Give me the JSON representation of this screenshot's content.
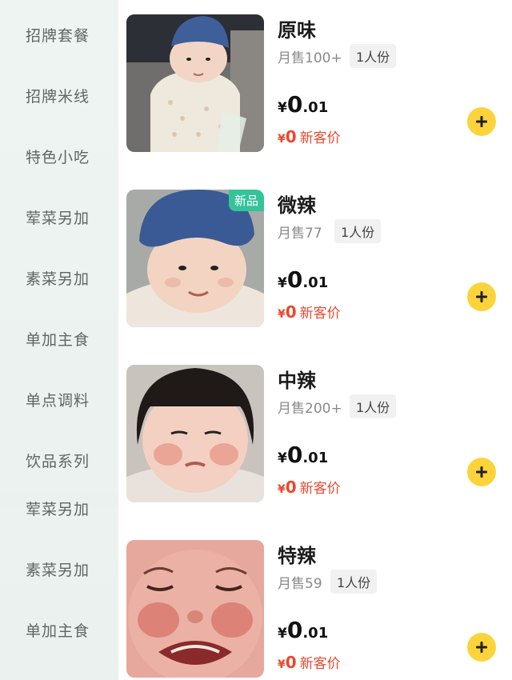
{
  "sidebar": {
    "items": [
      {
        "label": "招牌套餐"
      },
      {
        "label": "招牌米线"
      },
      {
        "label": "特色小吃"
      },
      {
        "label": "荤菜另加"
      },
      {
        "label": "素菜另加"
      },
      {
        "label": "单加主食"
      },
      {
        "label": "单点调料"
      },
      {
        "label": "饮品系列"
      },
      {
        "label": "荤菜另加"
      },
      {
        "label": "素菜另加"
      },
      {
        "label": "单加主食"
      }
    ]
  },
  "products": [
    {
      "name": "原味",
      "sales": "月售100+",
      "portion": "1人份",
      "price_currency": "¥",
      "price_int": "0",
      "price_dec": ".01",
      "new_currency": "¥",
      "new_price": "0",
      "new_label": "新客价",
      "badge": ""
    },
    {
      "name": "微辣",
      "sales": "月售77",
      "portion": "1人份",
      "price_currency": "¥",
      "price_int": "0",
      "price_dec": ".01",
      "new_currency": "¥",
      "new_price": "0",
      "new_label": "新客价",
      "badge": "新品"
    },
    {
      "name": "中辣",
      "sales": "月售200+",
      "portion": "1人份",
      "price_currency": "¥",
      "price_int": "0",
      "price_dec": ".01",
      "new_currency": "¥",
      "new_price": "0",
      "new_label": "新客价",
      "badge": ""
    },
    {
      "name": "特辣",
      "sales": "月售59",
      "portion": "1人份",
      "price_currency": "¥",
      "price_int": "0",
      "price_dec": ".01",
      "new_currency": "¥",
      "new_price": "0",
      "new_label": "新客价",
      "badge": ""
    }
  ],
  "colors": {
    "accent_add": "#fcd33b",
    "badge_green": "#35c39a",
    "new_price_red": "#e8492f",
    "sidebar_bg": "#eef4f2"
  },
  "icons": {
    "add": "plus-icon"
  }
}
